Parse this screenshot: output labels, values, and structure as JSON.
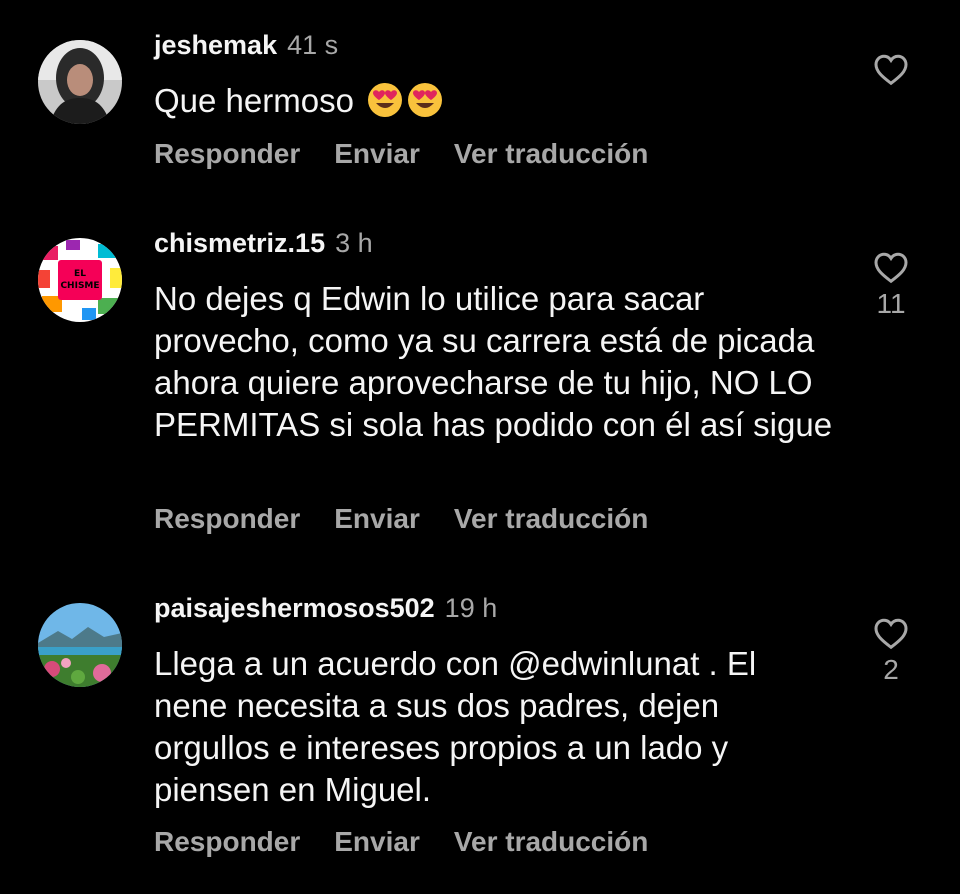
{
  "colors": {
    "background": "#000000",
    "primary_text": "#f5f5f5",
    "secondary_text": "#a8a8a8"
  },
  "action_labels": {
    "reply": "Responder",
    "send": "Enviar",
    "translate": "Ver traducción"
  },
  "comments": [
    {
      "username": "jeshemak",
      "time": "41 s",
      "text": "Que hermoso",
      "emojis": [
        "smiling-face-with-heart-eyes",
        "smiling-face-with-heart-eyes"
      ],
      "likes": "",
      "avatar": "profile-photo-woman"
    },
    {
      "username": "chismetriz.15",
      "time": "3 h",
      "text": "No dejes q Edwin lo utilice para sacar provecho, como ya su carrera está de picada ahora quiere aprovecharse de tu hijo, NO LO PERMITAS si sola has podido con él así sigue",
      "likes": "11",
      "avatar": "el-chisme-logo",
      "avatar_text": [
        "EL",
        "CHISME"
      ]
    },
    {
      "username": "paisajeshermosos502",
      "time": "19 h",
      "text": "Llega a un acuerdo con @edwinlunat . El nene necesita a sus dos padres, dejen orgullos e intereses propios a un lado y piensen en Miguel.",
      "likes": "2",
      "avatar": "landscape-photo"
    }
  ]
}
